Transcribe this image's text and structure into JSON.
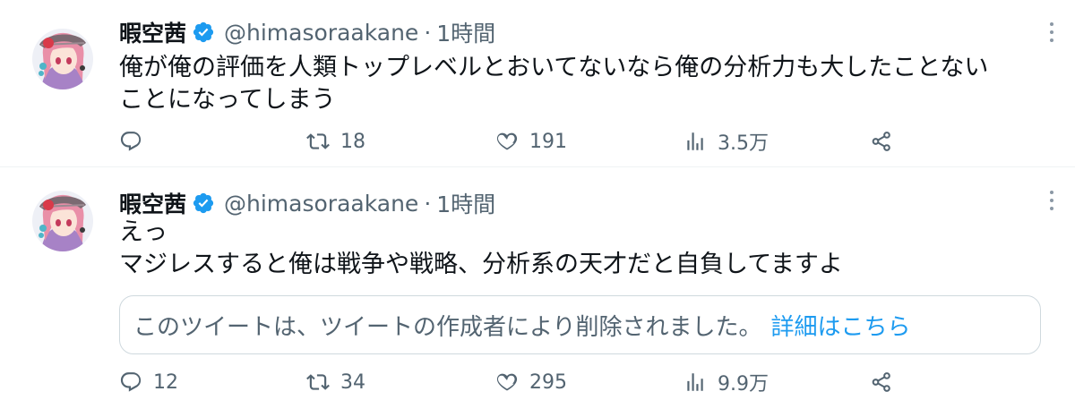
{
  "colors": {
    "text": "#0f1419",
    "secondary": "#536471",
    "link": "#1d9bf0",
    "verified": "#1d9bf0",
    "border": "#cfd9de",
    "divider": "#eff3f4"
  },
  "tweets": [
    {
      "author": {
        "display_name": "暇空茜",
        "verified_icon": "verified-badge-icon",
        "handle": "@himasoraakane"
      },
      "separator": "·",
      "time": "1時間",
      "text_lines": [
        "俺が俺の評価を人類トップレベルとおいてないなら俺の分析力も大したことない",
        "ことになってしまう"
      ],
      "actions": {
        "reply": {
          "icon": "reply-icon",
          "count": ""
        },
        "retweet": {
          "icon": "retweet-icon",
          "count": "18"
        },
        "like": {
          "icon": "heart-icon",
          "count": "191"
        },
        "views": {
          "icon": "views-chart-icon",
          "count": "3.5万"
        },
        "share": {
          "icon": "share-icon"
        }
      }
    },
    {
      "author": {
        "display_name": "暇空茜",
        "verified_icon": "verified-badge-icon",
        "handle": "@himasoraakane"
      },
      "separator": "·",
      "time": "1時間",
      "text_lines": [
        "えっ",
        "マジレスすると俺は戦争や戦略、分析系の天才だと自負してますよ"
      ],
      "quote": {
        "text": "このツイートは、ツイートの作成者により削除されました。",
        "link": "詳細はこちら"
      },
      "actions": {
        "reply": {
          "icon": "reply-icon",
          "count": "12"
        },
        "retweet": {
          "icon": "retweet-icon",
          "count": "34"
        },
        "like": {
          "icon": "heart-icon",
          "count": "295"
        },
        "views": {
          "icon": "views-chart-icon",
          "count": "9.9万"
        },
        "share": {
          "icon": "share-icon"
        }
      }
    }
  ]
}
